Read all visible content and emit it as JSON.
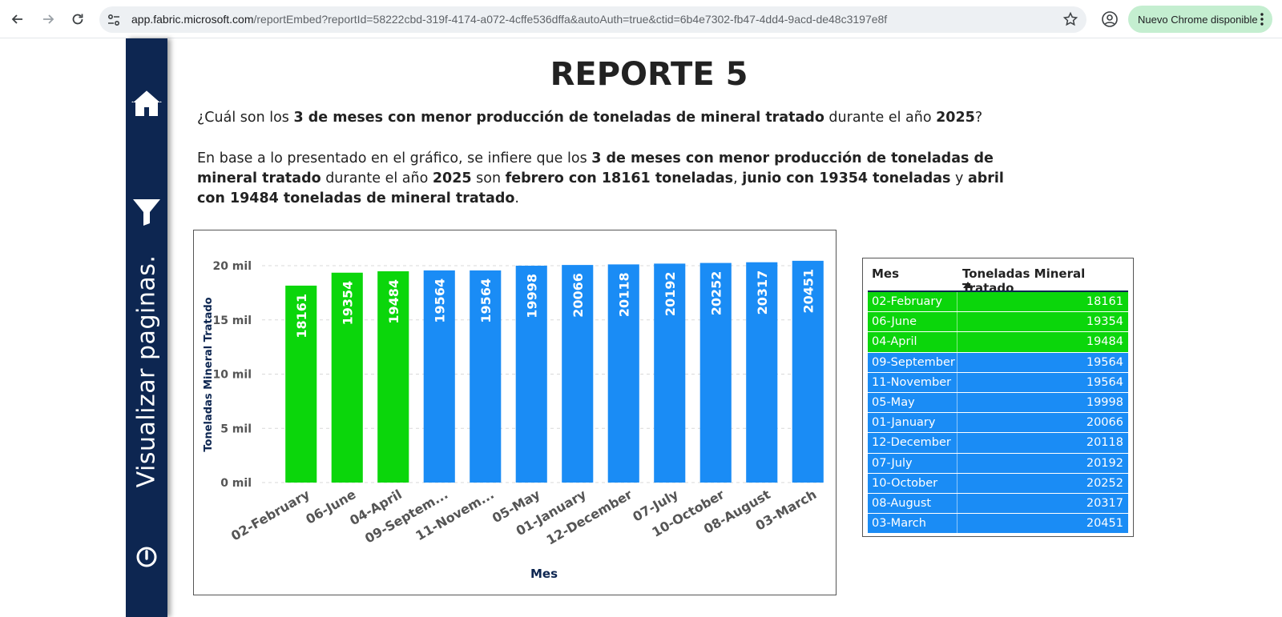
{
  "browser": {
    "url_host": "app.fabric.microsoft.com",
    "url_path": "/reportEmbed?reportId=58222cbd-319f-4174-a072-4cffe536dffa&autoAuth=true&ctid=6b4e7302-fb47-4dd4-9acd-de48c3197e8f",
    "update_label": "Nuevo Chrome disponible"
  },
  "nav": {
    "vertical_label": "Visualizar paginas."
  },
  "report": {
    "title": "REPORTE 5",
    "question": {
      "p1": "¿Cuál son los ",
      "b1": "3 de meses con menor producción de toneladas de mineral tratado",
      "p2": " durante el año ",
      "b2": "2025",
      "p3": "?"
    },
    "answer": {
      "p1": "En base a lo presentado en el gráfico, se infiere que los ",
      "b1": "3 de meses con menor producción de toneladas de mineral tratado",
      "p2": " durante el año ",
      "b2": "2025",
      "p3": " son ",
      "b3": "febrero con 18161 toneladas",
      "p4": ", ",
      "b4": "junio con 19354 toneladas",
      "p5": " y ",
      "b5": "abril con 19484 toneladas de mineral tratado",
      "p6": "."
    }
  },
  "colors": {
    "highlight": "#0bd60b",
    "normal": "#1a8cf5",
    "nav_bg": "#0d2651"
  },
  "chart_data": {
    "type": "bar",
    "categories": [
      "02-February",
      "06-June",
      "04-April",
      "09-Septem...",
      "11-Novem...",
      "05-May",
      "01-January",
      "12-December",
      "07-July",
      "10-October",
      "08-August",
      "03-March"
    ],
    "values": [
      18161,
      19354,
      19484,
      19564,
      19564,
      19998,
      20066,
      20118,
      20192,
      20252,
      20317,
      20451
    ],
    "highlighted": [
      true,
      true,
      true,
      false,
      false,
      false,
      false,
      false,
      false,
      false,
      false,
      false
    ],
    "ylim": [
      0,
      20000
    ],
    "yticks": [
      0,
      5000,
      10000,
      15000,
      20000
    ],
    "ytick_labels": [
      "0 mil",
      "5 mil",
      "10 mil",
      "15 mil",
      "20 mil"
    ],
    "xlabel": "Mes",
    "ylabel": "Toneladas Mineral Tratado",
    "grid": true
  },
  "table": {
    "columns": [
      "Mes",
      "Toneladas Mineral Tratado"
    ],
    "rows": [
      {
        "mes": "02-February",
        "val": "18161",
        "hl": true
      },
      {
        "mes": "06-June",
        "val": "19354",
        "hl": true
      },
      {
        "mes": "04-April",
        "val": "19484",
        "hl": true
      },
      {
        "mes": "09-September",
        "val": "19564",
        "hl": false
      },
      {
        "mes": "11-November",
        "val": "19564",
        "hl": false
      },
      {
        "mes": "05-May",
        "val": "19998",
        "hl": false
      },
      {
        "mes": "01-January",
        "val": "20066",
        "hl": false
      },
      {
        "mes": "12-December",
        "val": "20118",
        "hl": false
      },
      {
        "mes": "07-July",
        "val": "20192",
        "hl": false
      },
      {
        "mes": "10-October",
        "val": "20252",
        "hl": false
      },
      {
        "mes": "08-August",
        "val": "20317",
        "hl": false
      },
      {
        "mes": "03-March",
        "val": "20451",
        "hl": false
      }
    ]
  }
}
